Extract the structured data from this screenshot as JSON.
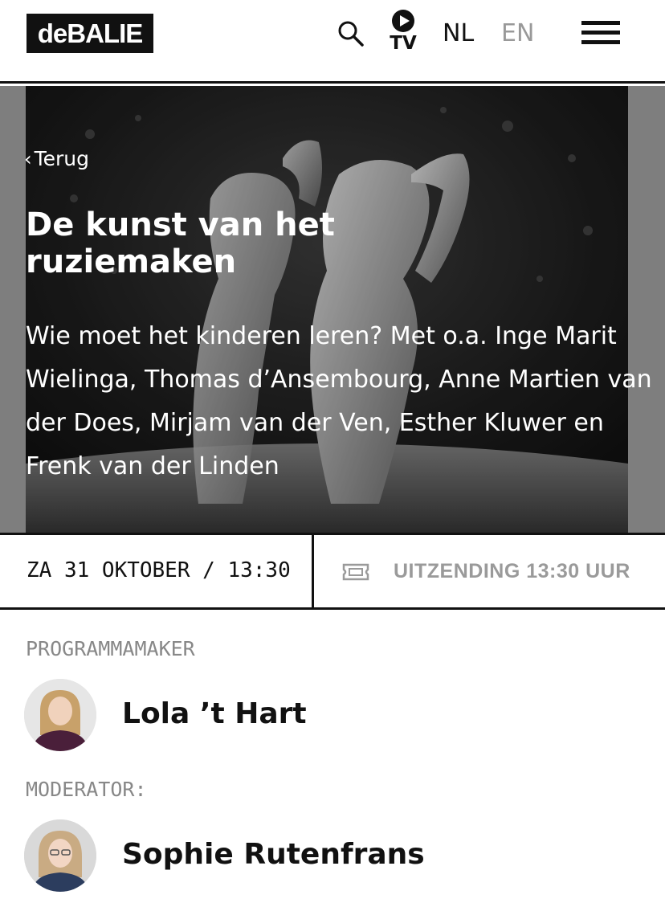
{
  "header": {
    "logo": "deBALIE",
    "tv_label": "TV",
    "lang_nl": "NL",
    "lang_en": "EN",
    "icons": [
      "search-icon",
      "play-icon",
      "hamburger-menu-icon"
    ]
  },
  "hero": {
    "back_label": "Terug",
    "title": "De kunst van het ruziemaken",
    "description": "Wie moet het kinderen leren? Met o.a. Inge Marit Wielinga, Thomas d’Ansembourg, Anne Martien van der Does, Mirjam van der Ven, Esther Kluwer en Frenk van der Linden"
  },
  "event": {
    "datetime": "ZA 31 OKTOBER / 13:30",
    "ticket_label": "UITZENDING 13:30 UUR",
    "ticket_icon": "ticket-icon"
  },
  "people": [
    {
      "role": "PROGRAMMAMAKER",
      "name": "Lola ’t Hart"
    },
    {
      "role": "MODERATOR:",
      "name": "Sophie Rutenfrans"
    }
  ],
  "colors": {
    "text": "#111111",
    "muted": "#999999",
    "hero_bg": "#9a9a9a"
  }
}
